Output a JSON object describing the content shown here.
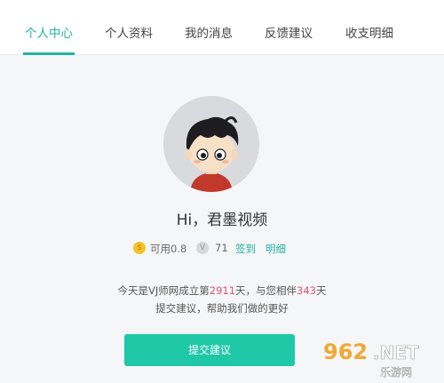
{
  "tabs": [
    {
      "label": "个人中心",
      "active": true
    },
    {
      "label": "个人资料",
      "active": false
    },
    {
      "label": "我的消息",
      "active": false
    },
    {
      "label": "反馈建议",
      "active": false
    },
    {
      "label": "收支明细",
      "active": false
    }
  ],
  "profile": {
    "greeting": "Hi，君墨视频"
  },
  "stats": {
    "gold_icon": "coin-icon",
    "available": "可用0.8",
    "v_icon": "v-coin-icon",
    "v_count": "71",
    "checkin": "签到",
    "details": "明细"
  },
  "info": {
    "prefix": "今天是VJ师网成立第",
    "site_days": "2911",
    "middle": "天，与您相伴",
    "user_days": "343",
    "suffix": "天",
    "line2": "提交建议，帮助我们做的更好"
  },
  "button": {
    "submit": "提交建议"
  },
  "watermark": {
    "text": "962.NET 乐游网"
  },
  "colors": {
    "accent": "#23b3a0",
    "button": "#1fc8a6",
    "highlight": "#e2536a"
  }
}
